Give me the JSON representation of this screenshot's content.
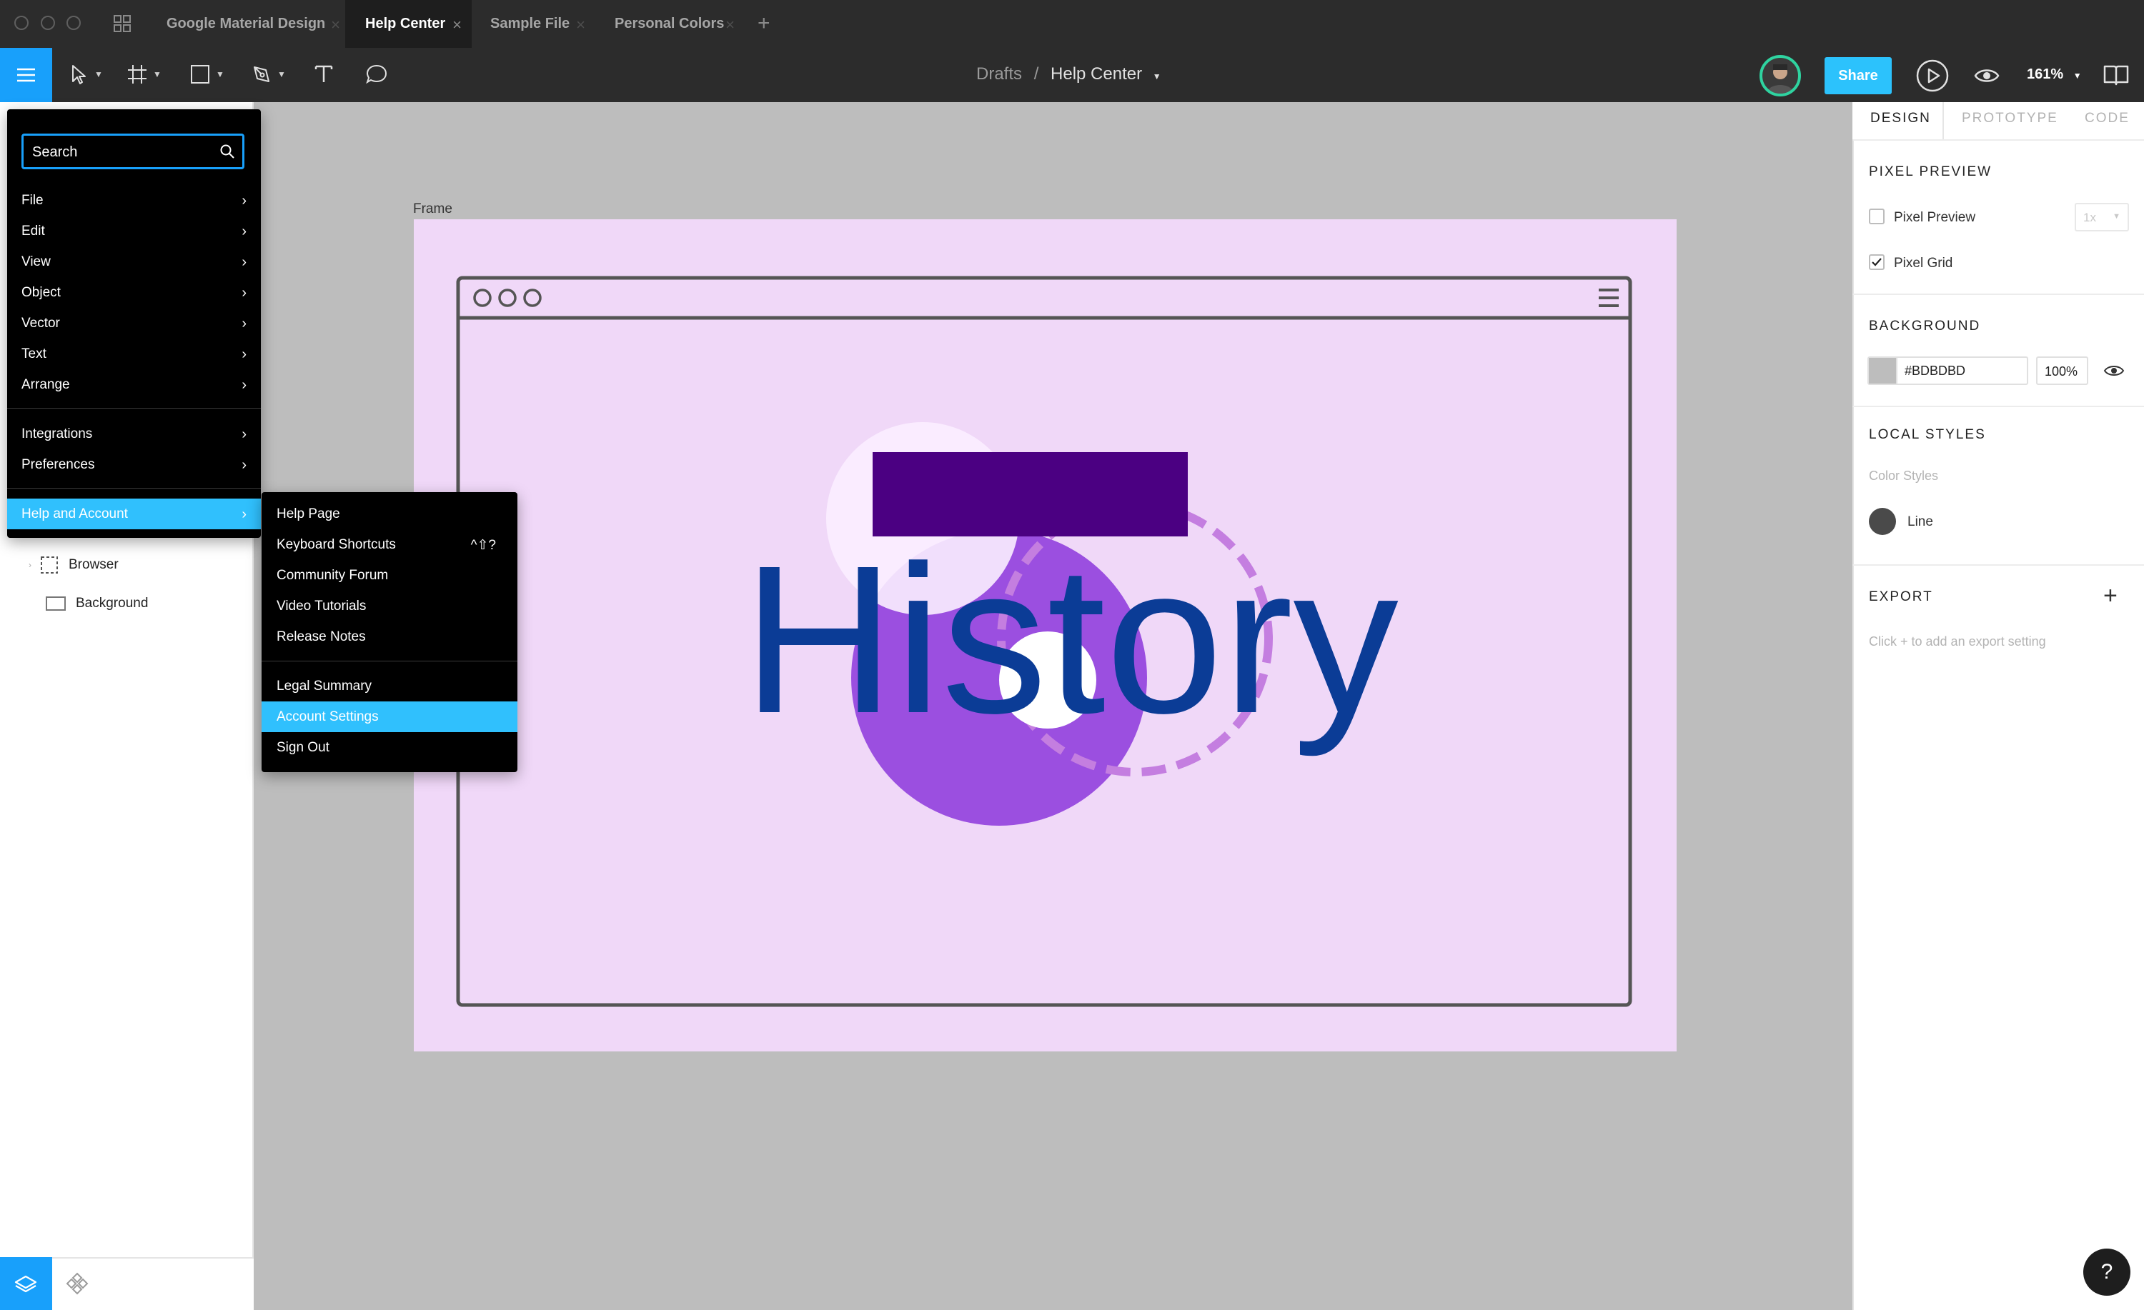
{
  "colors": {
    "accent": "#18A0FB",
    "share": "#2CC2FC",
    "frame_fill": "#F0D8F8",
    "history_text": "#0B3C96",
    "rect_fill": "#4B0082",
    "circle_purple": "#9B4FE0",
    "circle_light": "#FBEEFF",
    "dashed_ring": "#C47EE0",
    "canvas_bg": "#BDBDBD"
  },
  "tabs": [
    {
      "label": "Google Material Design",
      "close_icon": "close-icon"
    },
    {
      "label": "Help Center",
      "close_icon": "close-icon"
    },
    {
      "label": "Sample File",
      "close_icon": "close-icon"
    },
    {
      "label": "Personal Colors",
      "close_icon": "close-icon"
    }
  ],
  "toolbar": {
    "breadcrumb_root": "Drafts",
    "breadcrumb_sep": "/",
    "breadcrumb_current": "Help Center",
    "share_label": "Share",
    "zoom": "161%"
  },
  "menu": {
    "search_label": "Search",
    "items": [
      {
        "label": "File"
      },
      {
        "label": "Edit"
      },
      {
        "label": "View"
      },
      {
        "label": "Object"
      },
      {
        "label": "Vector"
      },
      {
        "label": "Text"
      },
      {
        "label": "Arrange"
      },
      {
        "label": "Integrations"
      },
      {
        "label": "Preferences"
      },
      {
        "label": "Help and Account"
      }
    ]
  },
  "submenu": {
    "items": [
      {
        "label": "Help Page"
      },
      {
        "label": "Keyboard Shortcuts",
        "shortcut": "^⇧?"
      },
      {
        "label": "Community Forum"
      },
      {
        "label": "Video Tutorials"
      },
      {
        "label": "Release Notes"
      },
      {
        "label": "Legal Summary"
      },
      {
        "label": "Account Settings"
      },
      {
        "label": "Sign Out"
      }
    ]
  },
  "layers": [
    {
      "label": "Browser"
    },
    {
      "label": "Background"
    }
  ],
  "canvas": {
    "frame_label": "Frame",
    "artwork_text": "History"
  },
  "right_panel": {
    "tabs": [
      "DESIGN",
      "PROTOTYPE",
      "CODE"
    ],
    "pixel_preview_title": "PIXEL PREVIEW",
    "pixel_preview_label": "Pixel Preview",
    "pixel_preview_checked": false,
    "pixel_preview_scale": "1x",
    "pixel_grid_label": "Pixel Grid",
    "pixel_grid_checked": true,
    "background_title": "BACKGROUND",
    "background_hex": "#BDBDBD",
    "background_opacity": "100%",
    "local_styles_title": "LOCAL STYLES",
    "color_styles_label": "Color Styles",
    "style_name": "Line",
    "export_title": "EXPORT",
    "export_hint": "Click + to add an export setting"
  },
  "help_label": "?"
}
